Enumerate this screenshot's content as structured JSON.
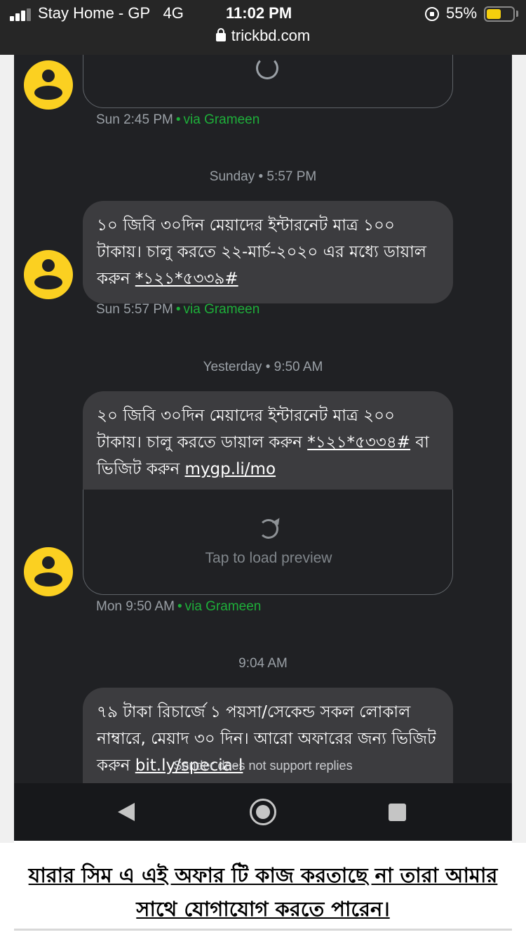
{
  "status_bar": {
    "carrier": "Stay Home - GP",
    "network": "4G",
    "time": "11:02 PM",
    "battery": "55%",
    "battery_level": 0.55,
    "url": "trickbd.com"
  },
  "thread": {
    "top_message": {
      "timestamp": "Sun 2:45 PM",
      "via": "via Grameen"
    },
    "messages": [
      {
        "date_separator": "Sunday • 5:57 PM",
        "text": "১০ জিবি ৩০দিন মেয়াদের ইন্টারনেট মাত্র ১০০ টাকায়। চালু করতে ২২-মার্চ-২০২০ এর মধ্যে ডায়াল করুন ",
        "link": "*১২১*৫৩৩৯#",
        "timestamp": "Sun 5:57 PM",
        "via": "via Grameen"
      },
      {
        "date_separator": "Yesterday • 9:50 AM",
        "text_part1": "২০ জিবি ৩০দিন মেয়াদের ইন্টারনেট মাত্র ২০০ টাকায়। চালু করতে ডায়াল করুন ",
        "link1": "*১২১*৫৩৩৪#",
        "text_part2": " বা ভিজিট করুন ",
        "link2": "mygp.li/mo",
        "preview_label": "Tap to load preview",
        "timestamp": "Mon 9:50 AM",
        "via": "via Grameen"
      },
      {
        "date_separator": "9:04 AM",
        "text": "৭৯ টাকা রিচার্জে ১ পয়সা/সেকেন্ড সকল লোকাল নাম্বারে, মেয়াদ ৩০ দিন। আরো অফারের জন্য ভিজিট করুন ",
        "link": "bit.ly/specia-l"
      }
    ],
    "no_reply_notice": "Sender does not support replies"
  },
  "caption": "যারার সিম এ এই অফার টি কাজ করতাছে না তারা আমার সাথে যোগাযোগ করতে পারেন।",
  "colors": {
    "background": "#202124",
    "bubble": "#3c3c3f",
    "avatar": "#fbd021",
    "via": "#1eaf3a"
  }
}
